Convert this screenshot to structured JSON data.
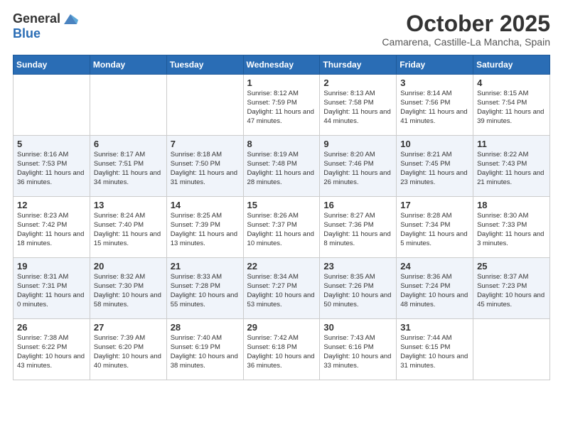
{
  "header": {
    "logo_line1": "General",
    "logo_line2": "Blue",
    "month": "October 2025",
    "location": "Camarena, Castille-La Mancha, Spain"
  },
  "days_of_week": [
    "Sunday",
    "Monday",
    "Tuesday",
    "Wednesday",
    "Thursday",
    "Friday",
    "Saturday"
  ],
  "weeks": [
    [
      {
        "day": "",
        "info": ""
      },
      {
        "day": "",
        "info": ""
      },
      {
        "day": "",
        "info": ""
      },
      {
        "day": "1",
        "info": "Sunrise: 8:12 AM\nSunset: 7:59 PM\nDaylight: 11 hours\nand 47 minutes."
      },
      {
        "day": "2",
        "info": "Sunrise: 8:13 AM\nSunset: 7:58 PM\nDaylight: 11 hours\nand 44 minutes."
      },
      {
        "day": "3",
        "info": "Sunrise: 8:14 AM\nSunset: 7:56 PM\nDaylight: 11 hours\nand 41 minutes."
      },
      {
        "day": "4",
        "info": "Sunrise: 8:15 AM\nSunset: 7:54 PM\nDaylight: 11 hours\nand 39 minutes."
      }
    ],
    [
      {
        "day": "5",
        "info": "Sunrise: 8:16 AM\nSunset: 7:53 PM\nDaylight: 11 hours\nand 36 minutes."
      },
      {
        "day": "6",
        "info": "Sunrise: 8:17 AM\nSunset: 7:51 PM\nDaylight: 11 hours\nand 34 minutes."
      },
      {
        "day": "7",
        "info": "Sunrise: 8:18 AM\nSunset: 7:50 PM\nDaylight: 11 hours\nand 31 minutes."
      },
      {
        "day": "8",
        "info": "Sunrise: 8:19 AM\nSunset: 7:48 PM\nDaylight: 11 hours\nand 28 minutes."
      },
      {
        "day": "9",
        "info": "Sunrise: 8:20 AM\nSunset: 7:46 PM\nDaylight: 11 hours\nand 26 minutes."
      },
      {
        "day": "10",
        "info": "Sunrise: 8:21 AM\nSunset: 7:45 PM\nDaylight: 11 hours\nand 23 minutes."
      },
      {
        "day": "11",
        "info": "Sunrise: 8:22 AM\nSunset: 7:43 PM\nDaylight: 11 hours\nand 21 minutes."
      }
    ],
    [
      {
        "day": "12",
        "info": "Sunrise: 8:23 AM\nSunset: 7:42 PM\nDaylight: 11 hours\nand 18 minutes."
      },
      {
        "day": "13",
        "info": "Sunrise: 8:24 AM\nSunset: 7:40 PM\nDaylight: 11 hours\nand 15 minutes."
      },
      {
        "day": "14",
        "info": "Sunrise: 8:25 AM\nSunset: 7:39 PM\nDaylight: 11 hours\nand 13 minutes."
      },
      {
        "day": "15",
        "info": "Sunrise: 8:26 AM\nSunset: 7:37 PM\nDaylight: 11 hours\nand 10 minutes."
      },
      {
        "day": "16",
        "info": "Sunrise: 8:27 AM\nSunset: 7:36 PM\nDaylight: 11 hours\nand 8 minutes."
      },
      {
        "day": "17",
        "info": "Sunrise: 8:28 AM\nSunset: 7:34 PM\nDaylight: 11 hours\nand 5 minutes."
      },
      {
        "day": "18",
        "info": "Sunrise: 8:30 AM\nSunset: 7:33 PM\nDaylight: 11 hours\nand 3 minutes."
      }
    ],
    [
      {
        "day": "19",
        "info": "Sunrise: 8:31 AM\nSunset: 7:31 PM\nDaylight: 11 hours\nand 0 minutes."
      },
      {
        "day": "20",
        "info": "Sunrise: 8:32 AM\nSunset: 7:30 PM\nDaylight: 10 hours\nand 58 minutes."
      },
      {
        "day": "21",
        "info": "Sunrise: 8:33 AM\nSunset: 7:28 PM\nDaylight: 10 hours\nand 55 minutes."
      },
      {
        "day": "22",
        "info": "Sunrise: 8:34 AM\nSunset: 7:27 PM\nDaylight: 10 hours\nand 53 minutes."
      },
      {
        "day": "23",
        "info": "Sunrise: 8:35 AM\nSunset: 7:26 PM\nDaylight: 10 hours\nand 50 minutes."
      },
      {
        "day": "24",
        "info": "Sunrise: 8:36 AM\nSunset: 7:24 PM\nDaylight: 10 hours\nand 48 minutes."
      },
      {
        "day": "25",
        "info": "Sunrise: 8:37 AM\nSunset: 7:23 PM\nDaylight: 10 hours\nand 45 minutes."
      }
    ],
    [
      {
        "day": "26",
        "info": "Sunrise: 7:38 AM\nSunset: 6:22 PM\nDaylight: 10 hours\nand 43 minutes."
      },
      {
        "day": "27",
        "info": "Sunrise: 7:39 AM\nSunset: 6:20 PM\nDaylight: 10 hours\nand 40 minutes."
      },
      {
        "day": "28",
        "info": "Sunrise: 7:40 AM\nSunset: 6:19 PM\nDaylight: 10 hours\nand 38 minutes."
      },
      {
        "day": "29",
        "info": "Sunrise: 7:42 AM\nSunset: 6:18 PM\nDaylight: 10 hours\nand 36 minutes."
      },
      {
        "day": "30",
        "info": "Sunrise: 7:43 AM\nSunset: 6:16 PM\nDaylight: 10 hours\nand 33 minutes."
      },
      {
        "day": "31",
        "info": "Sunrise: 7:44 AM\nSunset: 6:15 PM\nDaylight: 10 hours\nand 31 minutes."
      },
      {
        "day": "",
        "info": ""
      }
    ]
  ]
}
